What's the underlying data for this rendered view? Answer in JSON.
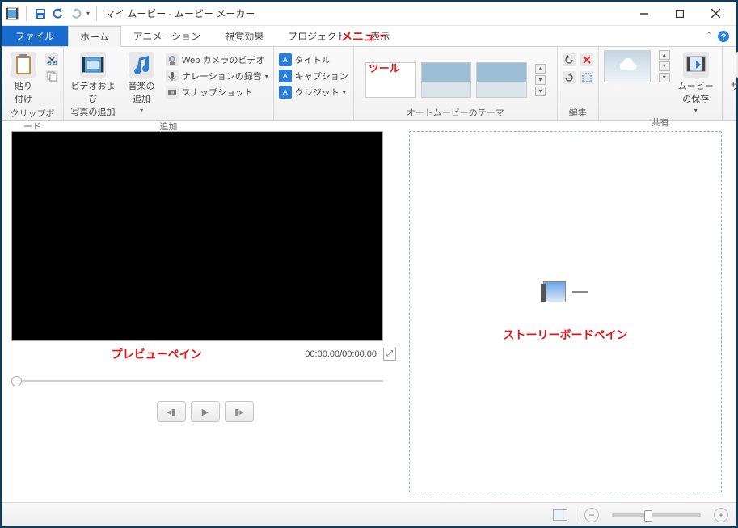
{
  "title": "マイ ムービー - ムービー メーカー",
  "tabs": {
    "file": "ファイル",
    "home": "ホーム",
    "animation": "アニメーション",
    "visual": "視覚効果",
    "project": "プロジェクト",
    "view": "表示"
  },
  "annotations": {
    "menu": "メニュー",
    "tool": "ツール",
    "preview": "プレビューペイン",
    "storyboard": "ストーリーボードペイン"
  },
  "ribbon": {
    "clipboard": {
      "paste": "貼り\n付け",
      "label": "クリップボード"
    },
    "add": {
      "addVideoPhoto": "ビデオおよび\n写真の追加",
      "addMusic": "音楽の\n追加",
      "webcam": "Web カメラのビデオ",
      "narration": "ナレーションの録音",
      "snapshot": "スナップショット",
      "label": "追加"
    },
    "text": {
      "title": "タイトル",
      "caption": "キャプション",
      "credits": "クレジット"
    },
    "themes": {
      "label": "オートムービーのテーマ"
    },
    "edit": {
      "label": "編集"
    },
    "share": {
      "saveMovie": "ムービー\nの保存",
      "label": "共有"
    },
    "signin": "サインイン"
  },
  "preview": {
    "time": "00:00.00/00:00.00"
  }
}
